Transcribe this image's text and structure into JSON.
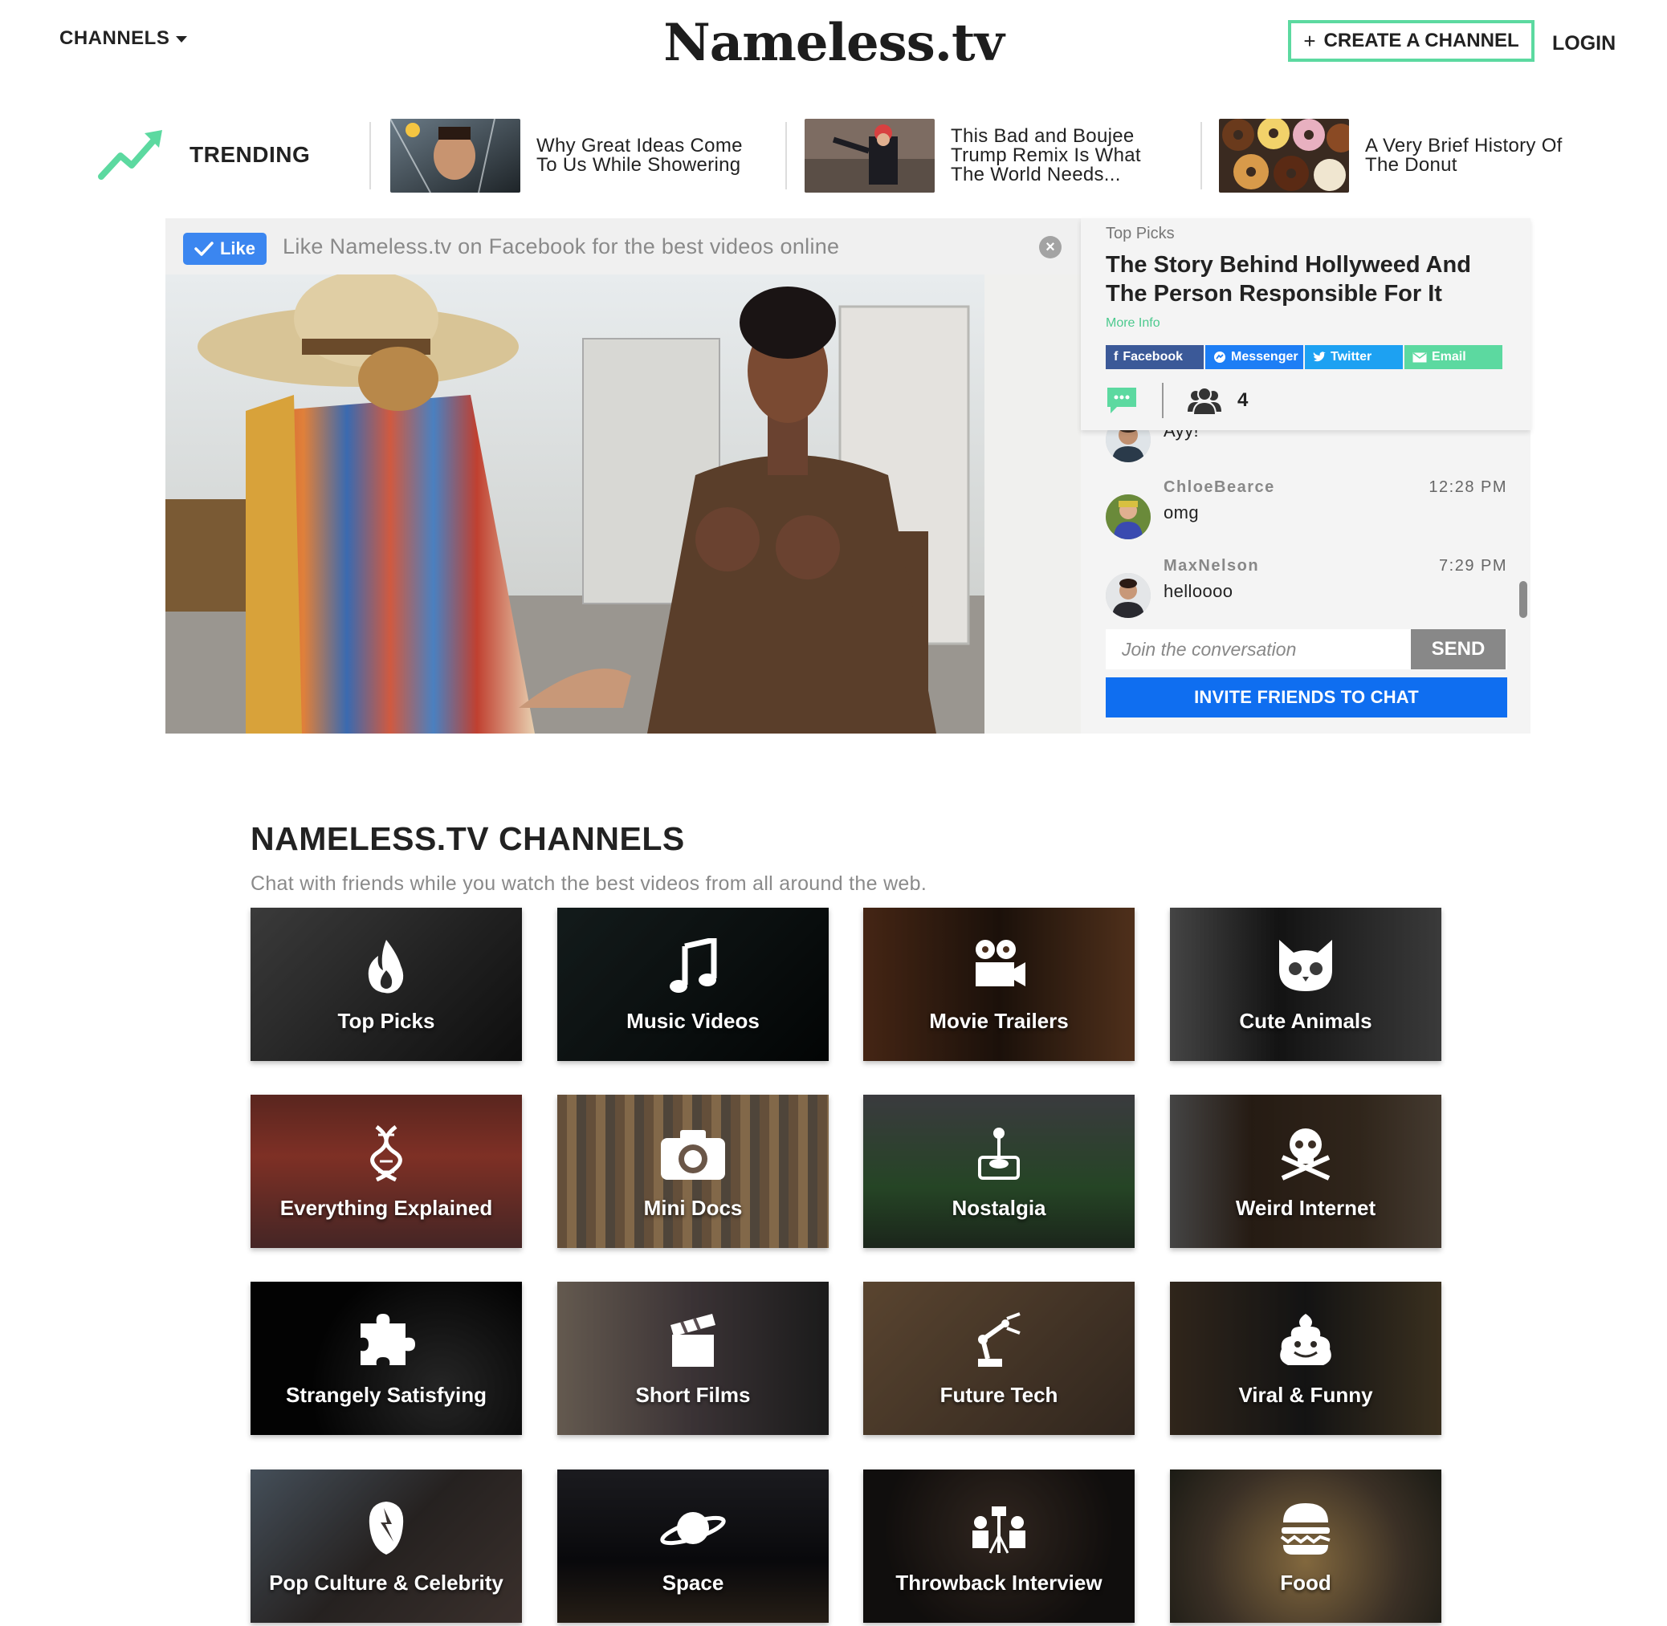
{
  "header": {
    "channels_label": "CHANNELS",
    "logo": "Nameless.tv",
    "create_button": "CREATE A CHANNEL",
    "login": "LOGIN"
  },
  "trending": {
    "label": "TRENDING",
    "items": [
      {
        "title": "Why Great Ideas Come To Us While Showering"
      },
      {
        "title": "This Bad and Boujee Trump Remix Is What The World Needs..."
      },
      {
        "title": "A Very Brief History Of The Donut"
      }
    ]
  },
  "facebook_bar": {
    "like_label": "Like",
    "text": "Like Nameless.tv on Facebook for the best videos online",
    "close_glyph": "×"
  },
  "sidebar": {
    "eyebrow": "Top Picks",
    "title": "The Story Behind Hollyweed And The Person Responsible For It",
    "more_info": "More Info",
    "share": {
      "facebook": "Facebook",
      "messenger": "Messenger",
      "twitter": "Twitter",
      "email": "Email"
    },
    "viewer_count": "4",
    "messages": [
      {
        "user": "",
        "time": "",
        "text": "Ayy!"
      },
      {
        "user": "ChloeBearce",
        "time": "12:28 PM",
        "text": "omg"
      },
      {
        "user": "MaxNelson",
        "time": "7:29 PM",
        "text": "helloooo"
      }
    ],
    "chat_placeholder": "Join the conversation",
    "send_label": "SEND",
    "invite_label": "INVITE FRIENDS TO CHAT"
  },
  "channels": {
    "title": "NAMELESS.TV CHANNELS",
    "subtitle": "Chat with friends while you watch the best videos from all around the web.",
    "tiles": [
      {
        "label": "Top Picks",
        "icon": "fire-icon",
        "color": "#2a2a2a"
      },
      {
        "label": "Music Videos",
        "icon": "music-note-icon",
        "color": "#0e1414"
      },
      {
        "label": "Movie Trailers",
        "icon": "movie-camera-icon",
        "color": "#4a2e1c"
      },
      {
        "label": "Cute Animals",
        "icon": "cat-face-icon",
        "color": "#3a3a3a"
      },
      {
        "label": "Everything Explained",
        "icon": "dna-icon",
        "color": "#5a2a22"
      },
      {
        "label": "Mini Docs",
        "icon": "camera-icon",
        "color": "#6a5648"
      },
      {
        "label": "Nostalgia",
        "icon": "joystick-icon",
        "color": "#3a4238"
      },
      {
        "label": "Weird Internet",
        "icon": "skull-crossbones-icon",
        "color": "#3c2e24"
      },
      {
        "label": "Strangely Satisfying",
        "icon": "puzzle-icon",
        "color": "#0a0a0a"
      },
      {
        "label": "Short Films",
        "icon": "clapperboard-icon",
        "color": "#5a4e52"
      },
      {
        "label": "Future Tech",
        "icon": "robot-arm-icon",
        "color": "#5a4434"
      },
      {
        "label": "Viral & Funny",
        "icon": "poop-icon",
        "color": "#2e2a26"
      },
      {
        "label": "Pop Culture & Celebrity",
        "icon": "bowie-face-icon",
        "color": "#3a3432"
      },
      {
        "label": "Space",
        "icon": "planet-icon",
        "color": "#1c1c20"
      },
      {
        "label": "Throwback Interview",
        "icon": "interview-icon",
        "color": "#2a2622"
      },
      {
        "label": "Food",
        "icon": "burger-icon",
        "color": "#5a4a3a"
      }
    ]
  },
  "colors": {
    "accent_green": "#5cd9a0",
    "facebook_blue": "#3b86f0",
    "invite_blue": "#0f6ef0",
    "send_gray": "#888888"
  }
}
